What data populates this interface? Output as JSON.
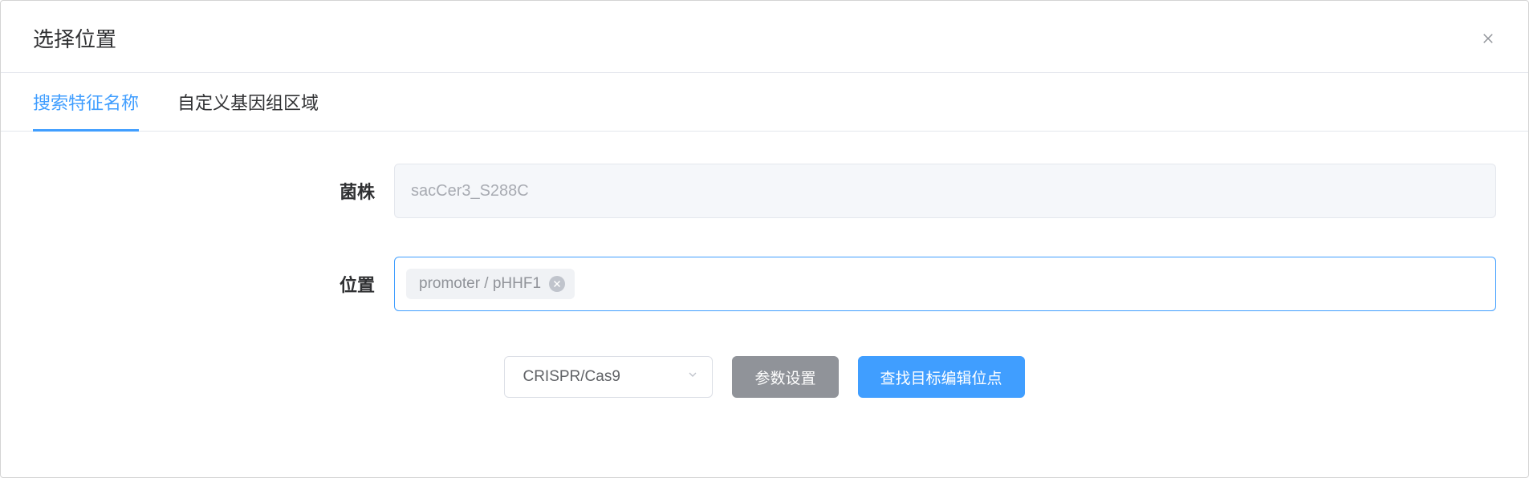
{
  "modal": {
    "title": "选择位置"
  },
  "tabs": {
    "search_feature": "搜索特征名称",
    "custom_region": "自定义基因组区域"
  },
  "form": {
    "strain_label": "菌株",
    "strain_value": "sacCer3_S288C",
    "position_label": "位置",
    "position_tag": "promoter / pHHF1"
  },
  "actions": {
    "method_select": "CRISPR/Cas9",
    "params_button": "参数设置",
    "search_button": "查找目标编辑位点"
  }
}
